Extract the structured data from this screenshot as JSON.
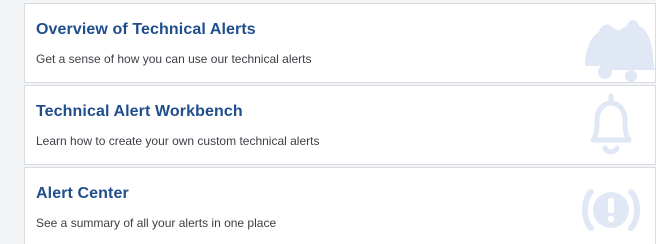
{
  "cards": [
    {
      "title": "Overview of Technical Alerts",
      "description": "Get a sense of how you can use our technical alerts",
      "icon": "bells-icon"
    },
    {
      "title": "Technical Alert Workbench",
      "description": "Learn how to create your own custom technical alerts",
      "icon": "bell-outline-icon"
    },
    {
      "title": "Alert Center",
      "description": "See a summary of all your alerts in one place",
      "icon": "exclamation-circle-icon"
    }
  ],
  "colors": {
    "title": "#1f4e8c",
    "description": "#3b3f45",
    "icon": "#dfe8f4",
    "card_bg": "#ffffff",
    "page_bg": "#f3f4f6",
    "border": "#d9dce1"
  }
}
